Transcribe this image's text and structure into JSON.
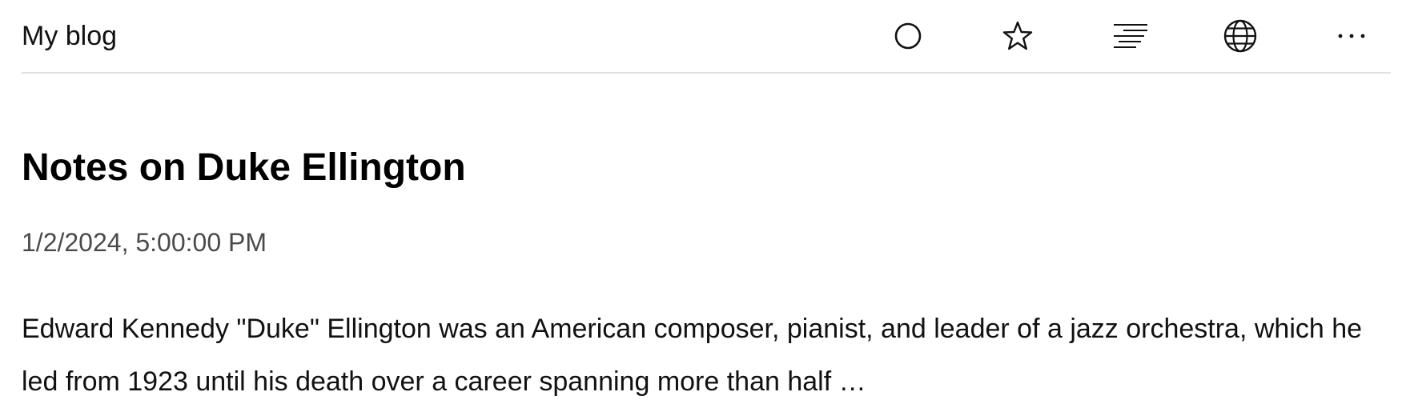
{
  "header": {
    "site_title": "My blog",
    "icons": [
      {
        "name": "circle-icon"
      },
      {
        "name": "star-icon"
      },
      {
        "name": "text-lines-icon"
      },
      {
        "name": "globe-icon"
      },
      {
        "name": "more-icon"
      }
    ]
  },
  "post": {
    "title": "Notes on Duke Ellington",
    "date": "1/2/2024, 5:00:00 PM",
    "excerpt": "Edward Kennedy \"Duke\" Ellington was an American composer, pianist, and leader of a jazz orchestra, which he led from 1923 until his death over a career spanning more than half …"
  }
}
